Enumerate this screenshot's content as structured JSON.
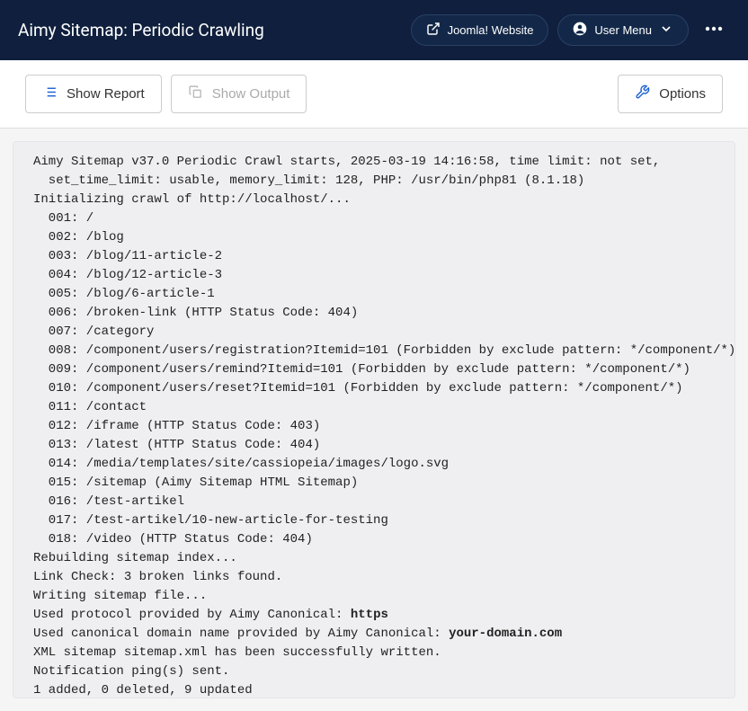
{
  "header": {
    "title": "Aimy Sitemap: Periodic Crawling",
    "website_btn": "Joomla! Website",
    "user_menu_btn": "User Menu"
  },
  "toolbar": {
    "show_report": "Show Report",
    "show_output": "Show Output",
    "options": "Options"
  },
  "output": {
    "lines_pre": "Aimy Sitemap v37.0 Periodic Crawl starts, 2025-03-19 14:16:58, time limit: not set,\n  set_time_limit: usable, memory_limit: 128, PHP: /usr/bin/php81 (8.1.18)\nInitializing crawl of http://localhost/...\n  001: /\n  002: /blog\n  003: /blog/11-article-2\n  004: /blog/12-article-3\n  005: /blog/6-article-1\n  006: /broken-link (HTTP Status Code: 404)\n  007: /category\n  008: /component/users/registration?Itemid=101 (Forbidden by exclude pattern: */component/*)\n  009: /component/users/remind?Itemid=101 (Forbidden by exclude pattern: */component/*)\n  010: /component/users/reset?Itemid=101 (Forbidden by exclude pattern: */component/*)\n  011: /contact\n  012: /iframe (HTTP Status Code: 403)\n  013: /latest (HTTP Status Code: 404)\n  014: /media/templates/site/cassiopeia/images/logo.svg\n  015: /sitemap (Aimy Sitemap HTML Sitemap)\n  016: /test-artikel\n  017: /test-artikel/10-new-article-for-testing\n  018: /video (HTTP Status Code: 404)\nRebuilding sitemap index...\nLink Check: 3 broken links found.\nWriting sitemap file...\nUsed protocol provided by Aimy Canonical: ",
    "protocol_bold": "https",
    "lines_mid": "\nUsed canonical domain name provided by Aimy Canonical: ",
    "domain_bold": "your-domain.com",
    "lines_post": "\nXML sitemap sitemap.xml has been successfully written.\nNotification ping(s) sent.\n1 added, 0 deleted, 9 updated"
  }
}
